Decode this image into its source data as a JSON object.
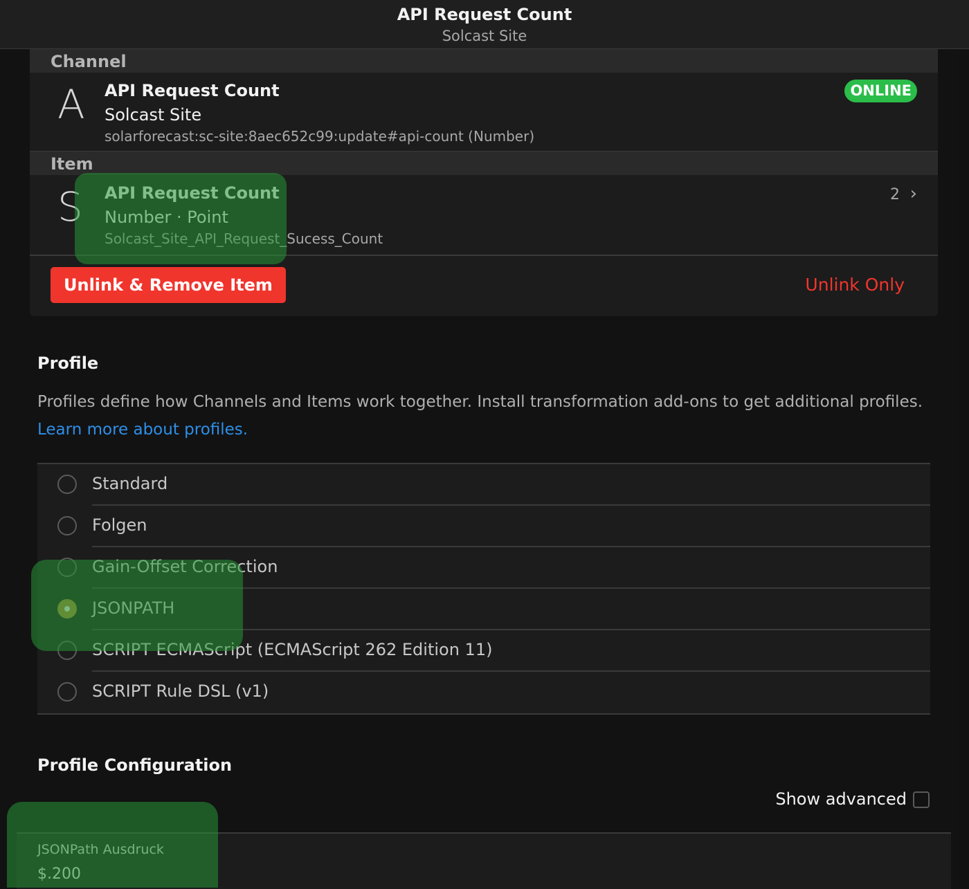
{
  "navbar": {
    "title": "API Request Count",
    "subtitle": "Solcast Site"
  },
  "channel": {
    "section_label": "Channel",
    "letter": "A",
    "title": "API Request Count",
    "subtitle": "Solcast Site",
    "uid": "solarforecast:sc-site:8aec652c99:update#api-count (Number)",
    "status": "ONLINE"
  },
  "item": {
    "section_label": "Item",
    "letter": "S",
    "title": "API Request Count",
    "subtitle": "Number · Point",
    "name": "Solcast_Site_API_Request_Sucess_Count",
    "count": "2"
  },
  "actions": {
    "unlink_remove": "Unlink & Remove Item",
    "unlink_only": "Unlink Only"
  },
  "profile": {
    "heading": "Profile",
    "description": "Profiles define how Channels and Items work together. Install transformation add-ons to get additional profiles.",
    "link": "Learn more about profiles.",
    "options": [
      {
        "label": "Standard",
        "checked": false
      },
      {
        "label": "Folgen",
        "checked": false
      },
      {
        "label": "Gain-Offset Correction",
        "checked": false
      },
      {
        "label": "JSONPATH",
        "checked": true
      },
      {
        "label": "SCRIPT ECMAScript (ECMAScript 262 Edition 11)",
        "checked": false
      },
      {
        "label": "SCRIPT Rule DSL (v1)",
        "checked": false
      }
    ]
  },
  "config": {
    "heading": "Profile Configuration",
    "show_advanced": "Show advanced",
    "show_advanced_checked": false,
    "field_label": "JSONPath Ausdruck",
    "field_value": "$.200"
  },
  "colors": {
    "accent_red": "#f0352d",
    "online_green": "#2bbd4a",
    "link_blue": "#2e8fe8",
    "radio_checked": "#a78433",
    "highlight": "#269637"
  }
}
